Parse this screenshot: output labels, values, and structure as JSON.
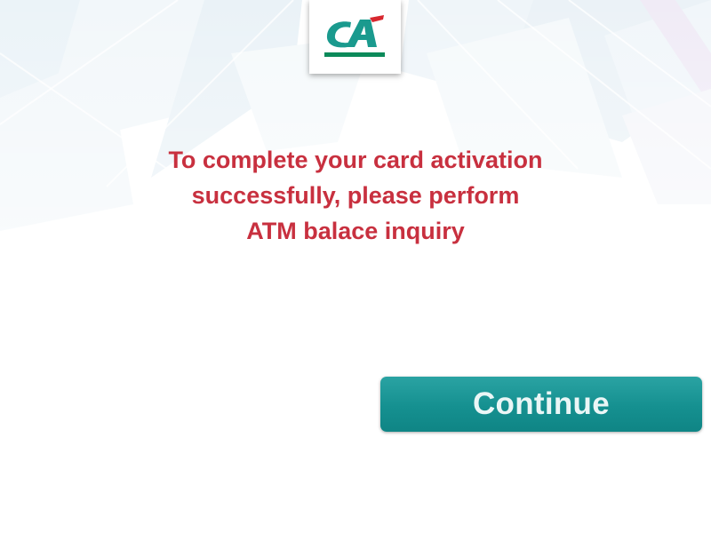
{
  "logo": {
    "name": "credit-agricole-logo",
    "colors": {
      "teal": "#1a9a8e",
      "red": "#d7272f",
      "green": "#0c8a5a"
    }
  },
  "message": {
    "lines": [
      "To complete your card activation",
      "successfully, please perform",
      "ATM balace inquiry"
    ],
    "color": "#c8303f"
  },
  "continue_button": {
    "label": "Continue",
    "color": "#159090"
  }
}
